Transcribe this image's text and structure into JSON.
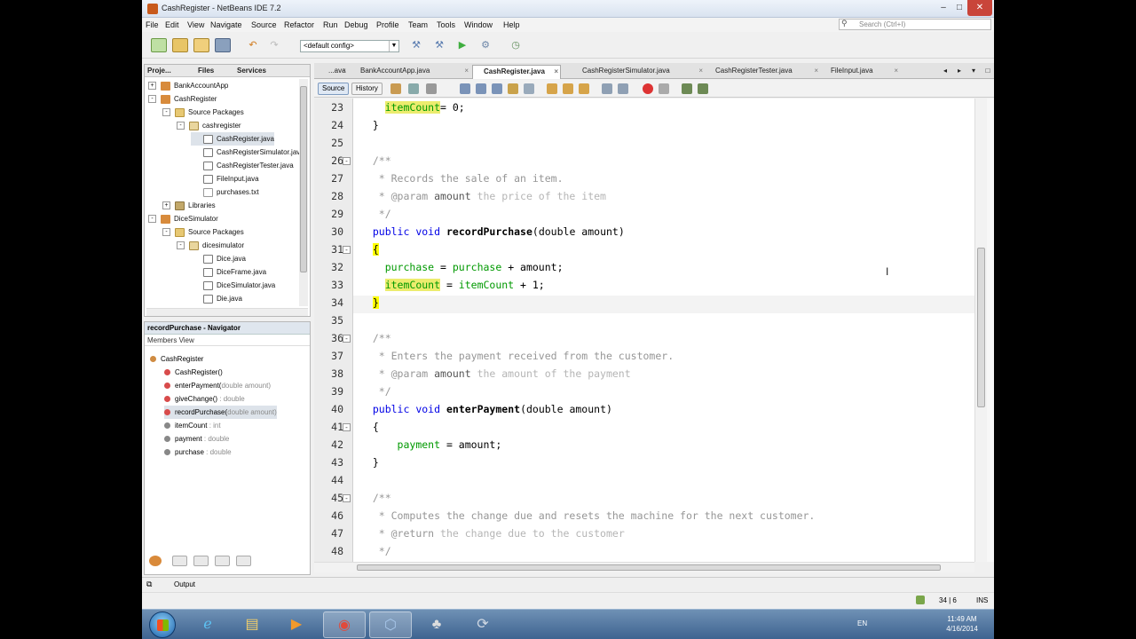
{
  "window": {
    "title": "CashRegister - NetBeans IDE 7.2"
  },
  "menu": [
    "File",
    "Edit",
    "View",
    "Navigate",
    "Source",
    "Refactor",
    "Run",
    "Debug",
    "Profile",
    "Team",
    "Tools",
    "Window",
    "Help"
  ],
  "search": {
    "placeholder": "Search (Ctrl+I)"
  },
  "toolbar": {
    "config_value": "<default config>"
  },
  "projects_panel": {
    "tabs": [
      "Proje...",
      "Files",
      "Services"
    ],
    "tree": [
      {
        "label": "BankAccountApp",
        "level": 0,
        "icon": "project-icon",
        "exp": "+"
      },
      {
        "label": "CashRegister",
        "level": 0,
        "icon": "project-icon",
        "exp": "-"
      },
      {
        "label": "Source Packages",
        "level": 1,
        "icon": "source-packages-icon",
        "exp": "-"
      },
      {
        "label": "cashregister",
        "level": 2,
        "icon": "package-icon",
        "exp": "-"
      },
      {
        "label": "CashRegister.java",
        "level": 3,
        "icon": "java-file-icon",
        "selected": true
      },
      {
        "label": "CashRegisterSimulator.java",
        "level": 3,
        "icon": "java-file-icon"
      },
      {
        "label": "CashRegisterTester.java",
        "level": 3,
        "icon": "java-file-icon"
      },
      {
        "label": "FileInput.java",
        "level": 3,
        "icon": "java-file-icon"
      },
      {
        "label": "purchases.txt",
        "level": 3,
        "icon": "text-file-icon"
      },
      {
        "label": "Libraries",
        "level": 1,
        "icon": "libraries-icon",
        "exp": "+"
      },
      {
        "label": "DiceSimulator",
        "level": 0,
        "icon": "project-icon",
        "exp": "-"
      },
      {
        "label": "Source Packages",
        "level": 1,
        "icon": "source-packages-icon",
        "exp": "-"
      },
      {
        "label": "dicesimulator",
        "level": 2,
        "icon": "package-icon",
        "exp": "-"
      },
      {
        "label": "Dice.java",
        "level": 3,
        "icon": "java-file-icon"
      },
      {
        "label": "DiceFrame.java",
        "level": 3,
        "icon": "java-file-icon"
      },
      {
        "label": "DiceSimulator.java",
        "level": 3,
        "icon": "java-file-icon"
      },
      {
        "label": "Die.java",
        "level": 3,
        "icon": "java-file-icon"
      }
    ]
  },
  "navigator": {
    "title": "recordPurchase - Navigator",
    "view": "Members View",
    "items": [
      {
        "name": "CashRegister",
        "type": "",
        "kind": "class",
        "level": 0
      },
      {
        "name": "CashRegister()",
        "type": "",
        "kind": "method",
        "level": 1
      },
      {
        "name": "enterPayment(",
        "type": "double amount)",
        "kind": "method",
        "level": 1
      },
      {
        "name": "giveChange()",
        "type": " : double",
        "kind": "method",
        "level": 1
      },
      {
        "name": "recordPurchase(",
        "type": "double amount)",
        "kind": "method",
        "level": 1,
        "selected": true
      },
      {
        "name": "itemCount",
        "type": " : int",
        "kind": "field",
        "level": 1
      },
      {
        "name": "payment",
        "type": " : double",
        "kind": "field",
        "level": 1
      },
      {
        "name": "purchase",
        "type": " : double",
        "kind": "field",
        "level": 1
      }
    ]
  },
  "editor_tabs": [
    {
      "label": "...ava"
    },
    {
      "label": "BankAccountApp.java"
    },
    {
      "label": "CashRegister.java",
      "active": true
    },
    {
      "label": "CashRegisterSimulator.java"
    },
    {
      "label": "CashRegisterTester.java"
    },
    {
      "label": "FileInput.java"
    }
  ],
  "editor_subtabs": {
    "source": "Source",
    "history": "History"
  },
  "code": {
    "lines": [
      {
        "n": "23",
        "fold": ""
      },
      {
        "n": "24",
        "fold": ""
      },
      {
        "n": "25",
        "fold": ""
      },
      {
        "n": "26",
        "fold": "-"
      },
      {
        "n": "27",
        "fold": ""
      },
      {
        "n": "28",
        "fold": ""
      },
      {
        "n": "29",
        "fold": ""
      },
      {
        "n": "30",
        "fold": ""
      },
      {
        "n": "31",
        "fold": "-"
      },
      {
        "n": "32",
        "fold": ""
      },
      {
        "n": "33",
        "fold": ""
      },
      {
        "n": "34",
        "fold": ""
      },
      {
        "n": "35",
        "fold": ""
      },
      {
        "n": "36",
        "fold": "-"
      },
      {
        "n": "37",
        "fold": ""
      },
      {
        "n": "38",
        "fold": ""
      },
      {
        "n": "39",
        "fold": ""
      },
      {
        "n": "40",
        "fold": ""
      },
      {
        "n": "41",
        "fold": "-"
      },
      {
        "n": "42",
        "fold": ""
      },
      {
        "n": "43",
        "fold": ""
      },
      {
        "n": "44",
        "fold": ""
      },
      {
        "n": "45",
        "fold": "-"
      },
      {
        "n": "46",
        "fold": ""
      },
      {
        "n": "47",
        "fold": ""
      },
      {
        "n": "48",
        "fold": ""
      }
    ],
    "t": {
      "l23_field": "itemCount",
      "l23_rest": "= 0;",
      "l24": "}",
      "l26": "/**",
      "l27": " * Records the sale of an item.",
      "l28_tag": " * @param",
      "l28_name": " amount",
      "l28_desc": " the price of the item",
      "l29": " */",
      "l30_kw": "public void",
      "l30_name": "recordPurchase",
      "l30_rest": "(double amount)",
      "l31": "{",
      "l32_f1": "purchase",
      "l32_eq": " = ",
      "l32_f2": "purchase",
      "l32_rest": " + amount;",
      "l33_f1": "itemCount",
      "l33_eq": " = ",
      "l33_f2": "itemCount",
      "l33_rest": " + 1;",
      "l34": "}",
      "l36": "/**",
      "l37": " * Enters the payment received from the customer.",
      "l38_tag": " * @param",
      "l38_name": " amount",
      "l38_desc": " the amount of the payment",
      "l39": " */",
      "l40_kw": "public void",
      "l40_name": "enterPayment",
      "l40_rest": "(double amount)",
      "l41": "{",
      "l42_f": "payment",
      "l42_rest": " = amount;",
      "l43": "}",
      "l45": "/**",
      "l46": " * Computes the change due and resets the machine for the next customer.",
      "l47_tag": " * @return",
      "l47_desc": " the change due to the customer",
      "l48": " */"
    }
  },
  "output": {
    "label": "Output"
  },
  "status": {
    "position": "34 | 6",
    "mode": "INS"
  },
  "taskbar": {
    "lang": "EN",
    "time": "11:49 AM",
    "date": "4/16/2014",
    "apps": [
      "ie-icon",
      "explorer-icon",
      "media-player-icon",
      "chrome-icon",
      "netbeans-icon",
      "paint-icon",
      "sync-icon"
    ]
  }
}
